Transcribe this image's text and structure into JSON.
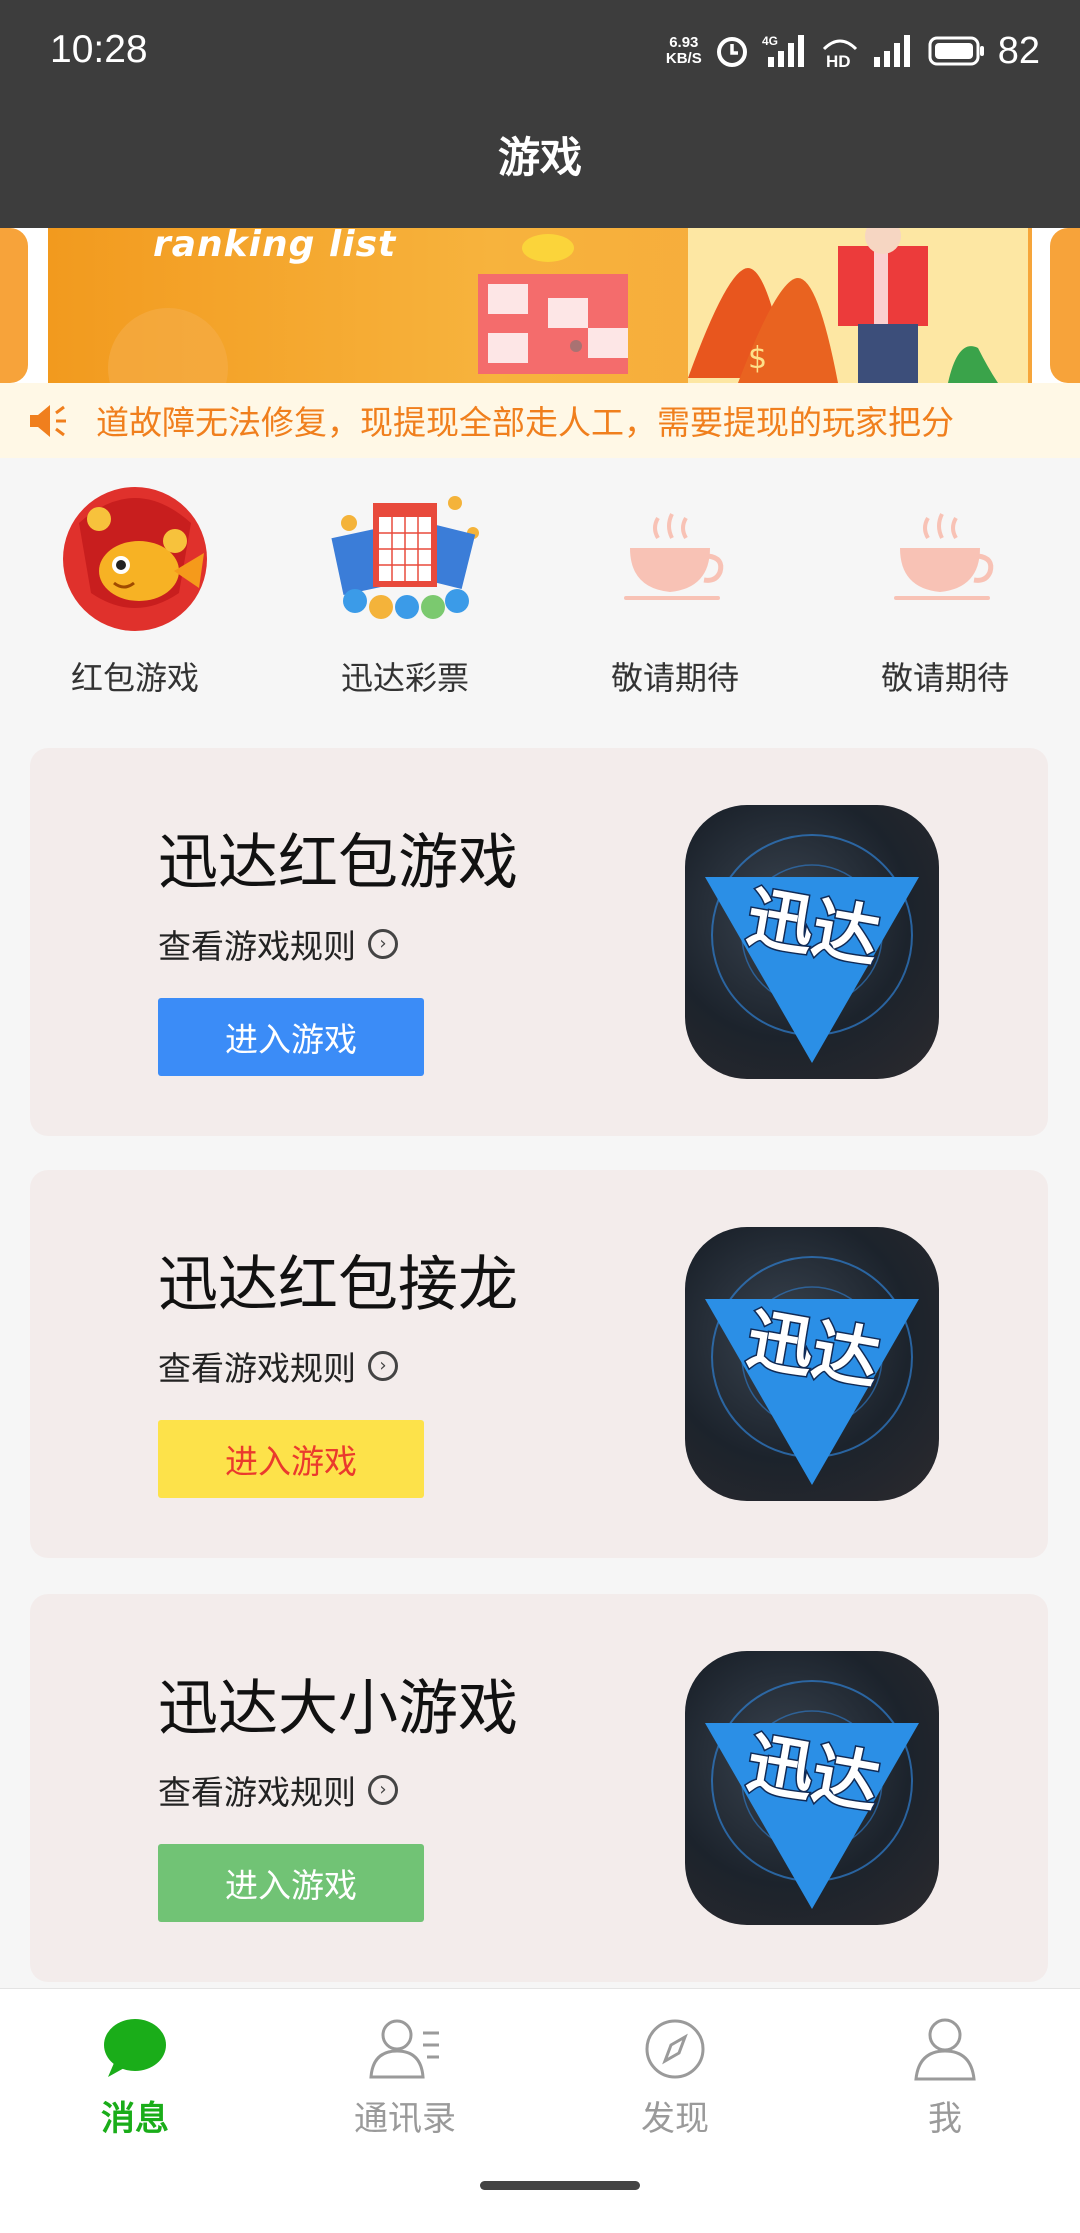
{
  "status": {
    "time": "10:28",
    "net_speed_value": "6.93",
    "net_speed_unit": "KB/S",
    "battery": "82"
  },
  "header": {
    "title": "游戏"
  },
  "banner": {
    "text": "ranking list"
  },
  "notice": {
    "text": "道故障无法修复，现提现全部走人工，需要提现的玩家把分"
  },
  "quick_menu": [
    {
      "label": "红包游戏",
      "icon": "red-packet-fish-icon"
    },
    {
      "label": "迅达彩票",
      "icon": "bingo-lottery-icon"
    },
    {
      "label": "敬请期待",
      "icon": "coffee-cup-icon"
    },
    {
      "label": "敬请期待",
      "icon": "coffee-cup-icon"
    }
  ],
  "games": [
    {
      "title": "迅达红包游戏",
      "rules": "查看游戏规则",
      "button": "进入游戏",
      "button_color": "#3b8cf7",
      "button_text_color": "#ffffff",
      "logo_text": "迅达"
    },
    {
      "title": "迅达红包接龙",
      "rules": "查看游戏规则",
      "button": "进入游戏",
      "button_color": "#fde24a",
      "button_text_color": "#ea3a2d",
      "logo_text": "迅达"
    },
    {
      "title": "迅达大小游戏",
      "rules": "查看游戏规则",
      "button": "进入游戏",
      "button_color": "#71c375",
      "button_text_color": "#ffffff",
      "logo_text": "迅达"
    }
  ],
  "bottom_nav": [
    {
      "label": "消息",
      "icon": "chat-bubble-icon",
      "active": true
    },
    {
      "label": "通讯录",
      "icon": "contacts-icon",
      "active": false
    },
    {
      "label": "发现",
      "icon": "compass-icon",
      "active": false
    },
    {
      "label": "我",
      "icon": "person-icon",
      "active": false
    }
  ],
  "colors": {
    "accent_green": "#1aad19",
    "title_bar": "#3d3d3d",
    "notice_text": "#f07f1d"
  }
}
